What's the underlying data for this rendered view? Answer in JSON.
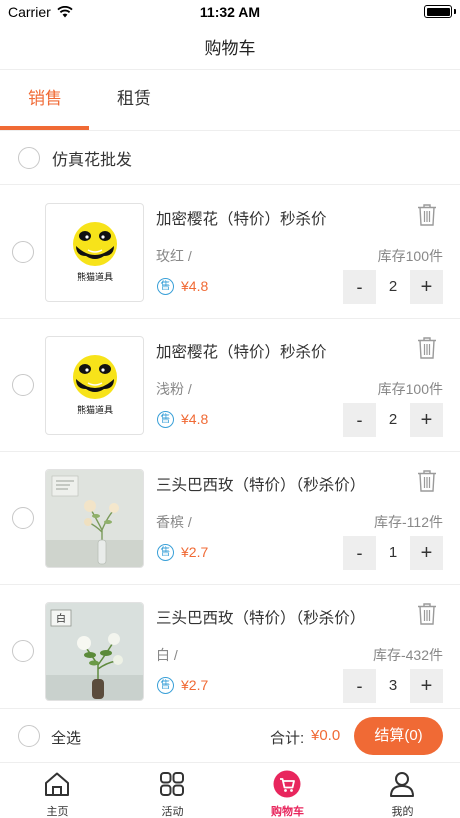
{
  "status_bar": {
    "carrier": "Carrier",
    "time": "11:32 AM"
  },
  "nav": {
    "title": "购物车"
  },
  "tabs": [
    {
      "label": "销售",
      "active": true
    },
    {
      "label": "租赁",
      "active": false
    }
  ],
  "shop": {
    "name": "仿真花批发"
  },
  "items": [
    {
      "title": "加密樱花（特价）秒杀价",
      "variant": "玫红 /",
      "stock": "库存100件",
      "badge": "售",
      "price": "¥4.8",
      "qty": "2",
      "minus": "-",
      "plus": "+",
      "logo_text": "熊猫道具"
    },
    {
      "title": "加密樱花（特价）秒杀价",
      "variant": "浅粉 /",
      "stock": "库存100件",
      "badge": "售",
      "price": "¥4.8",
      "qty": "2",
      "minus": "-",
      "plus": "+",
      "logo_text": "熊猫道具"
    },
    {
      "title": "三头巴西玫（特价）（秒杀价）",
      "variant": "香槟 /",
      "stock": "库存-112件",
      "badge": "售",
      "price": "¥2.7",
      "qty": "1",
      "minus": "-",
      "plus": "+"
    },
    {
      "title": "三头巴西玫（特价）（秒杀价）",
      "variant": "白 /",
      "stock": "库存-432件",
      "badge": "售",
      "price": "¥2.7",
      "qty": "3",
      "minus": "-",
      "plus": "+",
      "photo_tag": "白"
    }
  ],
  "footer": {
    "select_all": "全选",
    "total_label": "合计:",
    "total_value": "¥0.0",
    "checkout": "结算(0)"
  },
  "tabbar": [
    {
      "label": "主页",
      "icon": "home-icon",
      "active": false
    },
    {
      "label": "活动",
      "icon": "grid-icon",
      "active": false
    },
    {
      "label": "购物车",
      "icon": "cart-icon",
      "active": true
    },
    {
      "label": "我的",
      "icon": "user-icon",
      "active": false
    }
  ],
  "colors": {
    "accent": "#f06a35",
    "tab_active": "#e8265d",
    "badge": "#3aa0d8",
    "logo_yellow": "#f7e31a"
  }
}
